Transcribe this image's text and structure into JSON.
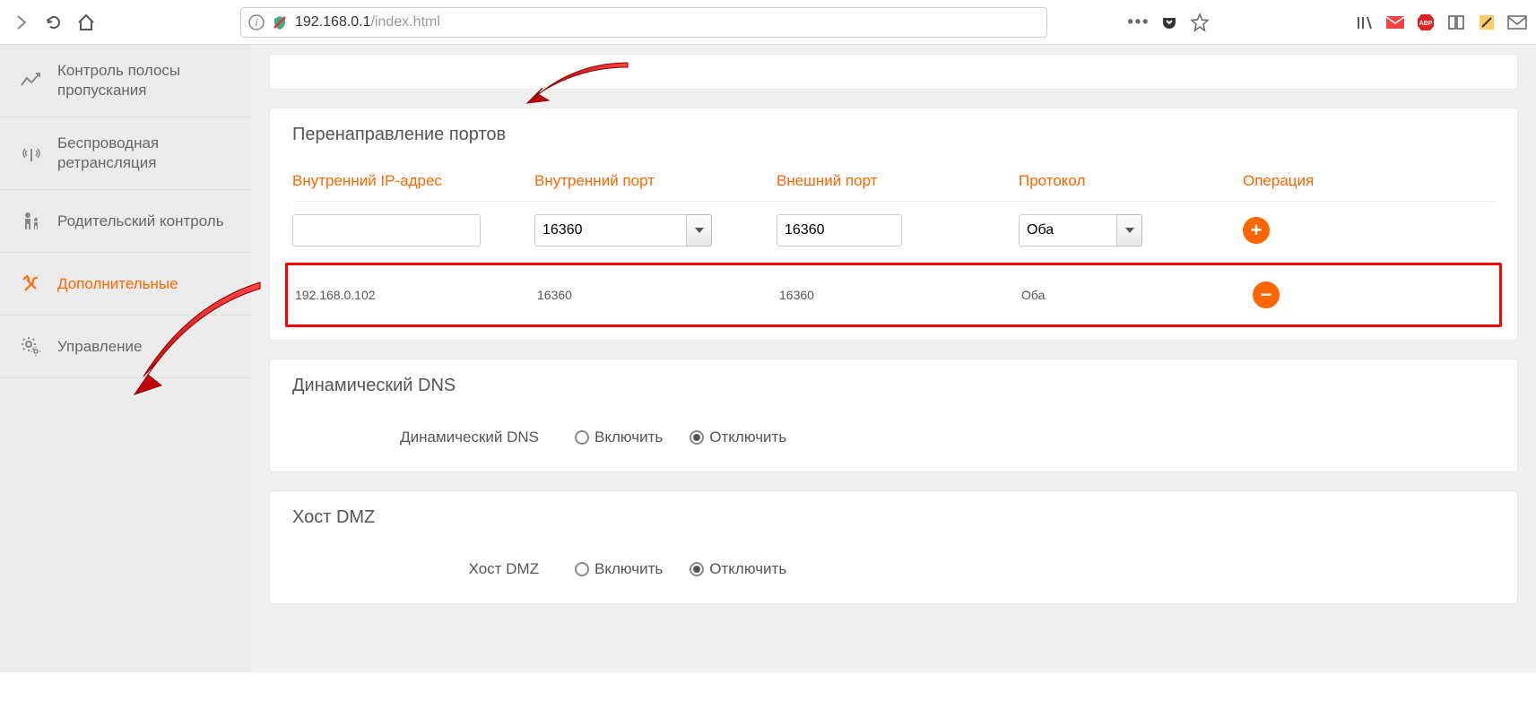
{
  "browser": {
    "url_host": "192.168.0.1",
    "url_path": "/index.html"
  },
  "sidebar": {
    "items": [
      {
        "label": "Контроль полосы пропускания",
        "icon": "bandwidth-icon"
      },
      {
        "label": "Беспроводная ретрансляция",
        "icon": "wireless-icon"
      },
      {
        "label": "Родительский контроль",
        "icon": "parental-icon"
      },
      {
        "label": "Дополнительные",
        "icon": "tools-icon",
        "active": true
      },
      {
        "label": "Управление",
        "icon": "gear-icon"
      }
    ]
  },
  "port_forwarding": {
    "title": "Перенаправление портов",
    "columns": {
      "internal_ip": "Внутренний IP-адрес",
      "internal_port": "Внутренний порт",
      "external_port": "Внешний порт",
      "protocol": "Протокол",
      "operation": "Операция"
    },
    "new_row": {
      "internal_ip": "",
      "internal_port": "16360",
      "external_port": "16360",
      "protocol": "Оба"
    },
    "rows": [
      {
        "internal_ip": "192.168.0.102",
        "internal_port": "16360",
        "external_port": "16360",
        "protocol": "Оба"
      }
    ]
  },
  "ddns": {
    "title": "Динамический DNS",
    "label": "Динамический DNS",
    "enable": "Включить",
    "disable": "Отключить",
    "value": "disable"
  },
  "dmz": {
    "title": "Хост DMZ",
    "label": "Хост DMZ",
    "enable": "Включить",
    "disable": "Отключить",
    "value": "disable"
  }
}
